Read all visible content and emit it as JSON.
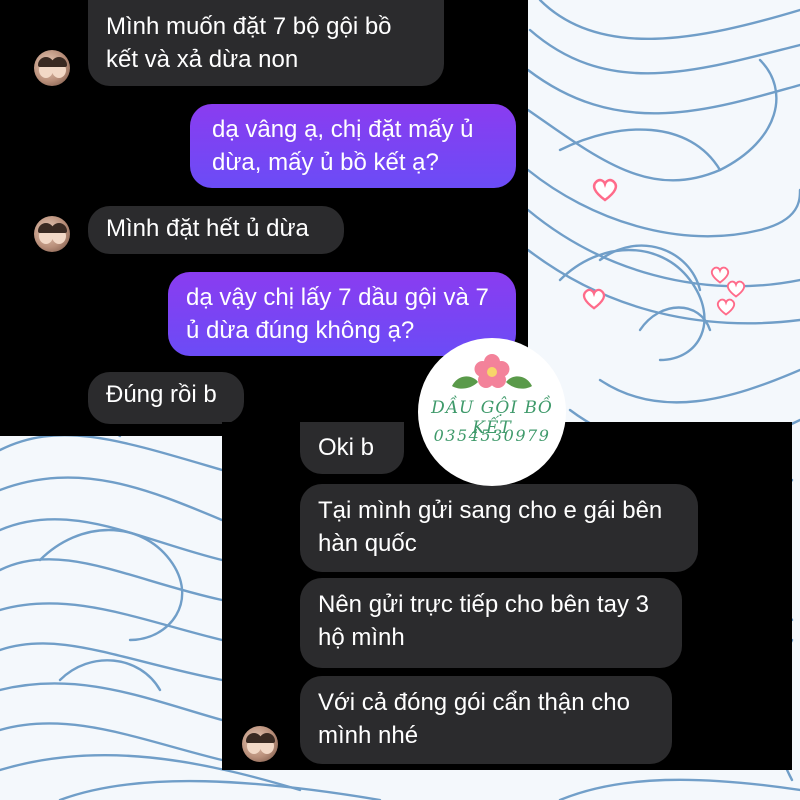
{
  "chat_top": {
    "messages": [
      {
        "role": "received",
        "text": "Mình muốn đặt 7 bộ gội bồ kết và xả dừa non"
      },
      {
        "role": "sent",
        "text": "dạ vâng ạ, chị đặt mấy ủ dừa, mấy ủ bồ kết ạ?"
      },
      {
        "role": "received",
        "text": "Mình đặt hết ủ dừa"
      },
      {
        "role": "sent",
        "text": "dạ vậy chị lấy 7 dầu gội và 7 ủ dừa đúng không ạ?"
      },
      {
        "role": "received",
        "text": "Đúng rồi b"
      }
    ]
  },
  "chat_bottom": {
    "messages": [
      {
        "role": "received",
        "text": "Oki b"
      },
      {
        "role": "received",
        "text": "Tại mình gửi sang cho e gái bên hàn quốc"
      },
      {
        "role": "received",
        "text": "Nên gửi trực tiếp cho bên tay 3 hộ mình"
      },
      {
        "role": "received",
        "text": "Với cả đóng gói cẩn thận cho mình nhé"
      }
    ]
  },
  "logo": {
    "name": "DẦU GỘI BỒ KẾT",
    "phone": "0354530979"
  },
  "colors": {
    "background": "#f4f8fc",
    "wave_lines": "#5a8fc0",
    "received_bubble": "#2b2b2d",
    "sent_bubble": "#7a44f2",
    "logo_text": "#3f9a6b",
    "hearts": "#ff6b8a"
  },
  "icons": [
    "flower-icon",
    "leaf-icon",
    "heart-icon",
    "avatar"
  ]
}
